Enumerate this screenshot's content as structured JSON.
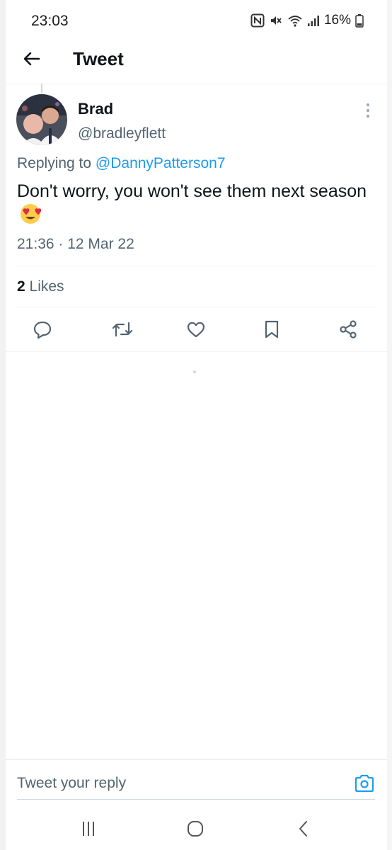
{
  "status_bar": {
    "time": "23:03",
    "battery_percent": "16%",
    "icons": [
      "nfc-icon",
      "mute-icon",
      "wifi-icon",
      "signal-icon",
      "battery-icon"
    ]
  },
  "header": {
    "title": "Tweet",
    "back_icon": "arrow-left-icon"
  },
  "tweet": {
    "author_name": "Brad",
    "author_handle": "@bradleyflett",
    "replying_to_prefix": "Replying to",
    "replying_to_handle": "@DannyPatterson7",
    "text": "Don't worry, you won't see them next season",
    "emoji": "smiling-face-with-heart-eyes",
    "timestamp": "21:36 · 12 Mar 22",
    "likes_count": "2",
    "likes_label": "Likes"
  },
  "actions": [
    "reply-icon",
    "retweet-icon",
    "like-icon",
    "bookmark-icon",
    "share-icon"
  ],
  "reply_bar": {
    "placeholder": "Tweet your reply",
    "camera_icon": "camera-icon"
  },
  "nav_bar": {
    "icons": [
      "recent-apps-icon",
      "home-icon",
      "back-icon"
    ]
  },
  "colors": {
    "accent": "#1d9bf0",
    "text_primary": "#0f1419",
    "text_secondary": "#536471",
    "divider": "#eff3f4"
  }
}
